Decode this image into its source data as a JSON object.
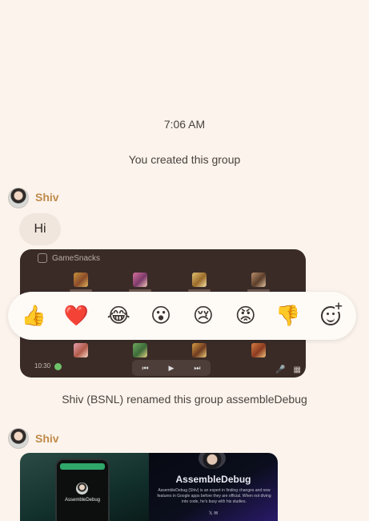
{
  "timestamp": "7:06 AM",
  "system_messages": {
    "created": "You created this group",
    "renamed": "Shiv (BSNL) renamed this group assembleDebug"
  },
  "messages": [
    {
      "sender": "Shiv",
      "text": "Hi"
    },
    {
      "sender": "Shiv"
    }
  ],
  "game_card": {
    "app_name": "GameSnacks",
    "clock": "10:30",
    "media_controls": [
      "⏮",
      "▶",
      "⏭"
    ]
  },
  "reactions": [
    {
      "name": "thumbs-up",
      "glyph": "👍"
    },
    {
      "name": "red-heart",
      "glyph": "❤️"
    },
    {
      "name": "tears-of-joy",
      "glyph": "😂"
    },
    {
      "name": "surprised",
      "glyph": "😮"
    },
    {
      "name": "crying",
      "glyph": "😢"
    },
    {
      "name": "angry",
      "glyph": "😡"
    },
    {
      "name": "thumbs-down",
      "glyph": "👎"
    },
    {
      "name": "add-reaction",
      "glyph": "+"
    }
  ],
  "shared_card": {
    "phone_name": "AssembleDebug",
    "title": "AssembleDebug",
    "description": "AssembleDebug (Shiv) is an expert in finding changes and new features in Google apps before they are official. When not diving into code, he's busy with his studies.",
    "social_icons": "𝕏  ✉"
  },
  "colors": {
    "background": "#fbf3ec",
    "sender_name": "#c08a4a",
    "bubble": "#f1e6dd",
    "game_card_bg": "#3a2b27"
  }
}
